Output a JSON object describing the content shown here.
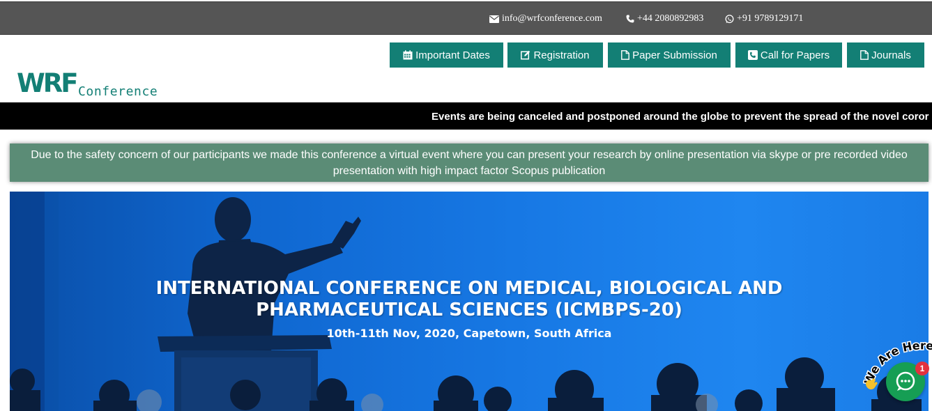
{
  "topbar": {
    "email": "info@wrfconference.com",
    "phone": "+44 2080892983",
    "whatsapp": "+91 9789129171",
    "background_color": "#555555"
  },
  "logo": {
    "mark": "WRF",
    "word": "Conference",
    "color": "#137f75"
  },
  "nav": {
    "color": "#137f75",
    "items": [
      {
        "label": "Important Dates",
        "icon": "calendar-icon"
      },
      {
        "label": "Registration",
        "icon": "edit-icon"
      },
      {
        "label": "Paper Submission",
        "icon": "document-icon"
      },
      {
        "label": "Call for Papers",
        "icon": "phone-square-icon"
      },
      {
        "label": "Journals",
        "icon": "document-icon"
      }
    ]
  },
  "ticker": {
    "text": "Events are being canceled and postponed around the globe to prevent the spread of the novel coror"
  },
  "notice": {
    "text": "Due to the safety concern of our participants we made this conference a virtual event where you can present your research by online presentation via skype or pre recorded video presentation with high impact factor Scopus publication",
    "background_color": "#5b8c76"
  },
  "hero": {
    "title_line1": "INTERNATIONAL CONFERENCE ON MEDICAL, BIOLOGICAL AND",
    "title_line2": "PHARMACEUTICAL SCIENCES (ICMBPS-20)",
    "subtitle": "10th-11th Nov, 2020, Capetown, South Africa"
  },
  "chat": {
    "label": "We Are Here!",
    "badge_count": "1",
    "color": "#169e54",
    "icon": "chat-bubble-icon"
  }
}
